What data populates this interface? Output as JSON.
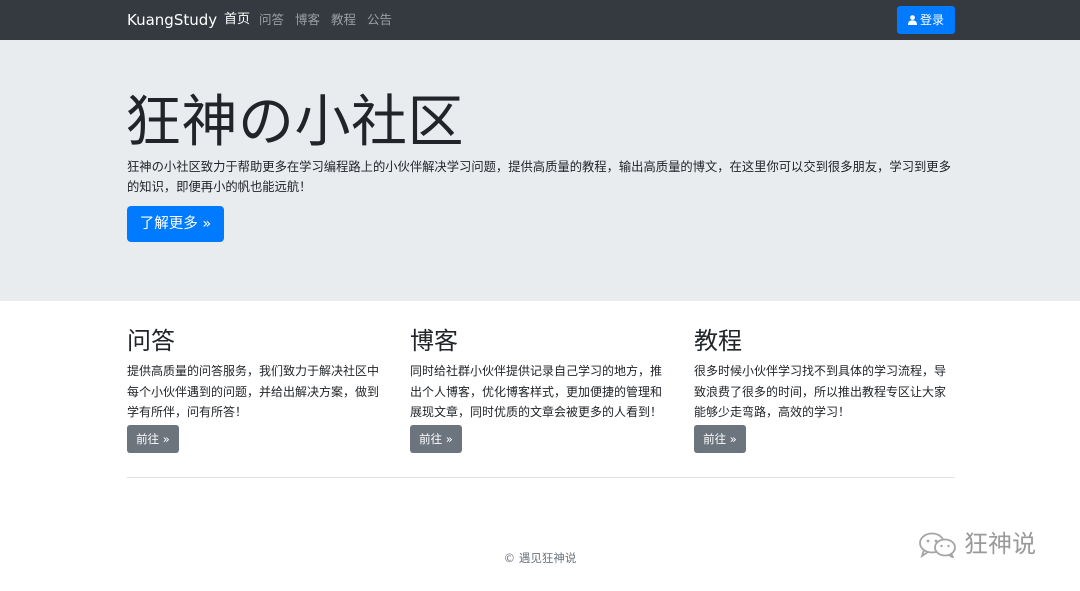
{
  "navbar": {
    "brand": "KuangStudy",
    "links": [
      {
        "label": "首页",
        "active": true
      },
      {
        "label": "问答",
        "active": false
      },
      {
        "label": "博客",
        "active": false
      },
      {
        "label": "教程",
        "active": false
      },
      {
        "label": "公告",
        "active": false
      }
    ],
    "login_label": "登录",
    "login_icon": "user-icon"
  },
  "jumbotron": {
    "title": "狂神の小社区",
    "text": "狂神の小社区致力于帮助更多在学习编程路上的小伙伴解决学习问题，提供高质量的教程，输出高质量的博文，在这里你可以交到很多朋友，学习到更多的知识，即便再小的帆也能远航！",
    "button_label": "了解更多 »"
  },
  "columns": [
    {
      "title": "问答",
      "text": "提供高质量的问答服务，我们致力于解决社区中每个小伙伴遇到的问题，并给出解决方案，做到学有所伴，问有所答！",
      "button_label": "前往 »"
    },
    {
      "title": "博客",
      "text": "同时给社群小伙伴提供记录自己学习的地方，推出个人博客，优化博客样式，更加便捷的管理和展现文章，同时优质的文章会被更多的人看到！",
      "button_label": "前往 »"
    },
    {
      "title": "教程",
      "text": "很多时候小伙伴学习找不到具体的学习流程，导致浪费了很多的时间，所以推出教程专区让大家能够少走弯路，高效的学习！",
      "button_label": "前往 »"
    }
  ],
  "footer": {
    "text": "© 遇见狂神说"
  },
  "watermark": {
    "text": "狂神说",
    "icon": "wechat-icon"
  },
  "colors": {
    "navbar": "#343a40",
    "primary": "#007bff",
    "secondary": "#6c757d",
    "jumbotron": "#e9ecef"
  }
}
